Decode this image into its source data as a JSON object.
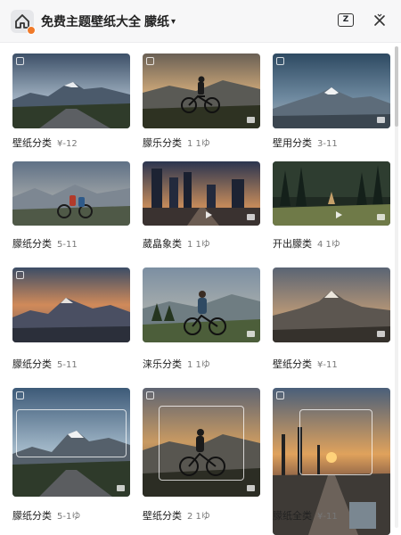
{
  "header": {
    "title": "免费主题壁纸大全",
    "category": "朦纸",
    "chevron_icon": "chevron-down-icon",
    "app_icon": "home-icon",
    "badge_color": "#f07a2a"
  },
  "toolbar": {
    "z_label": "Z",
    "close_icon": "close-icon"
  },
  "wallpapers": [
    {
      "title": "壁纸分类",
      "meta": "¥-12"
    },
    {
      "title": "朦乐分类",
      "meta": "1 1ゆ"
    },
    {
      "title": "壁用分类",
      "meta": "3-11"
    },
    {
      "title": "朦纸分类",
      "meta": "5-11"
    },
    {
      "title": "葳皛象类",
      "meta": "1 1ゆ"
    },
    {
      "title": "开出朦类",
      "meta": "4 1ゆ"
    },
    {
      "title": "朦纸分类",
      "meta": "5-11"
    },
    {
      "title": "涞乐分类",
      "meta": "1 1ゆ"
    },
    {
      "title": "壁纸分类",
      "meta": "¥-11"
    },
    {
      "title": "朦纸分类",
      "meta": "5-1ゆ"
    },
    {
      "title": "壁纸分类",
      "meta": "2 1ゆ"
    },
    {
      "title": "朦纸全类",
      "meta": "¥-11"
    }
  ]
}
